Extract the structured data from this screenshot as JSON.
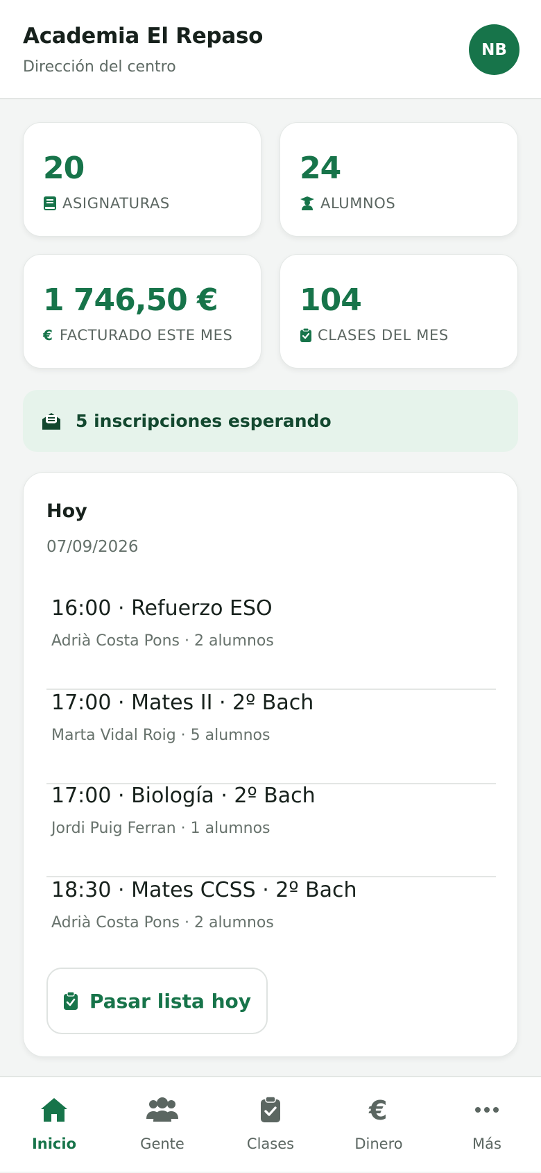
{
  "header": {
    "title": "Academia El Repaso",
    "subtitle": "Dirección del centro",
    "avatar_initials": "NB"
  },
  "stats": [
    {
      "value": "20",
      "label": "ASIGNATURAS",
      "icon": "book-icon"
    },
    {
      "value": "24",
      "label": "ALUMNOS",
      "icon": "graduate-icon"
    },
    {
      "value": "1 746,50 €",
      "label": "FACTURADO ESTE MES",
      "icon": "euro-icon"
    },
    {
      "value": "104",
      "label": "CLASES DEL MES",
      "icon": "clipboard-check-icon"
    }
  ],
  "banner": {
    "text": "5 inscripciones esperando",
    "icon": "envelope-open-icon"
  },
  "today": {
    "title": "Hoy",
    "date": "07/09/2026",
    "classes": [
      {
        "main": "16:00 · Refuerzo ESO",
        "sub": "Adrià Costa Pons · 2 alumnos"
      },
      {
        "main": "17:00 · Mates II · 2º Bach",
        "sub": "Marta Vidal Roig · 5 alumnos"
      },
      {
        "main": "17:00 · Biología · 2º Bach",
        "sub": "Jordi Puig Ferran · 1 alumnos"
      },
      {
        "main": "18:30 · Mates CCSS · 2º Bach",
        "sub": "Adrià Costa Pons · 2 alumnos"
      }
    ],
    "button_label": "Pasar lista hoy"
  },
  "nav": {
    "items": [
      {
        "label": "Inicio",
        "icon": "home-icon",
        "active": true
      },
      {
        "label": "Gente",
        "icon": "people-icon",
        "active": false
      },
      {
        "label": "Clases",
        "icon": "clipboard-check-icon",
        "active": false
      },
      {
        "label": "Dinero",
        "icon": "euro-icon",
        "active": false
      },
      {
        "label": "Más",
        "icon": "more-icon",
        "active": false
      }
    ]
  },
  "colors": {
    "accent": "#17744a",
    "banner_bg": "#e6f3eb",
    "nav_inactive": "#5b6661"
  }
}
